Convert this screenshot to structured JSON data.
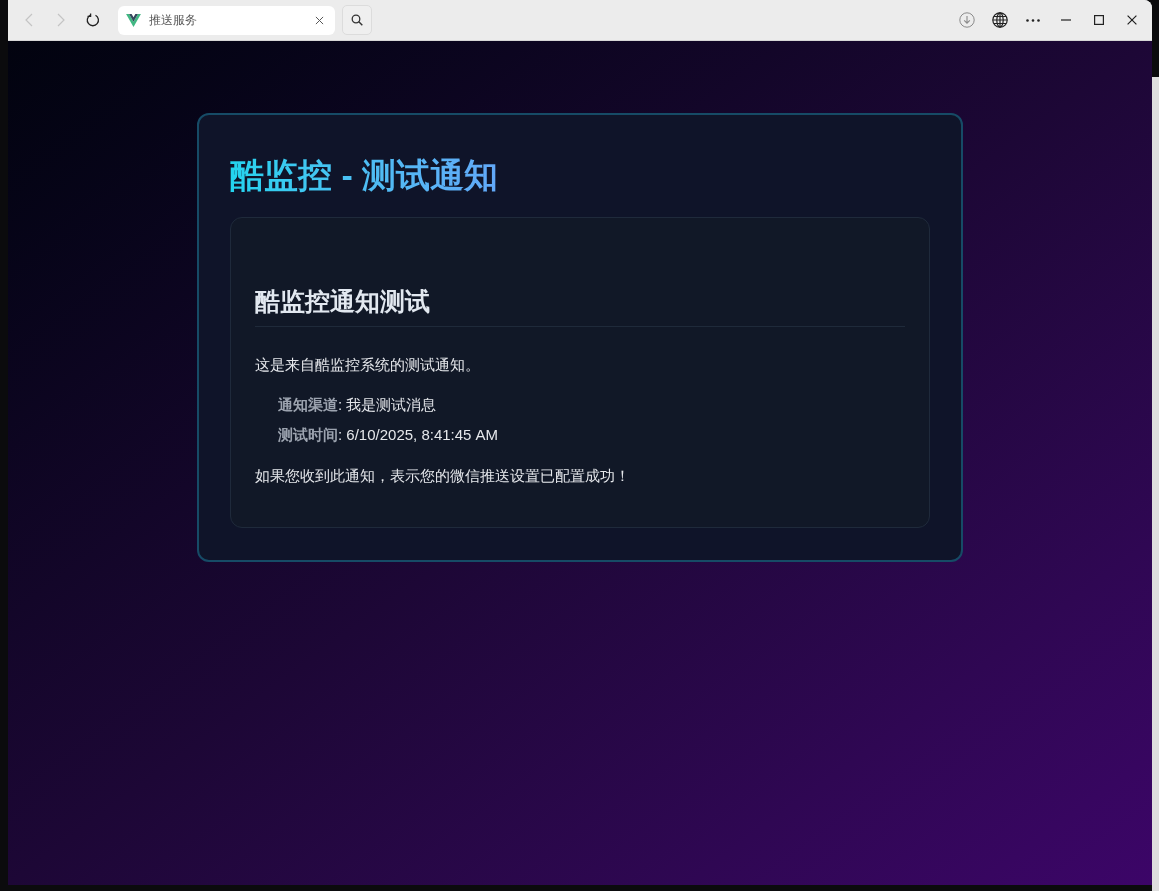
{
  "browser": {
    "nav_buttons": [
      {
        "kind": "back",
        "disabled": true
      },
      {
        "kind": "forward",
        "disabled": true
      },
      {
        "kind": "reload",
        "disabled": false
      }
    ],
    "tab": {
      "title": "推送服务"
    }
  },
  "page": {
    "title": "酷监控 - 测试通知",
    "message": {
      "heading": "酷监控通知测试",
      "intro": "这是来自酷监控系统的测试通知。",
      "details": [
        "**通知渠道**: 我是测试消息",
        "**测试时间**: 6/10/2025, 8:41:45 AM"
      ],
      "closing": "如果您收到此通知，表示您的微信推送设置已配置成功！"
    }
  }
}
